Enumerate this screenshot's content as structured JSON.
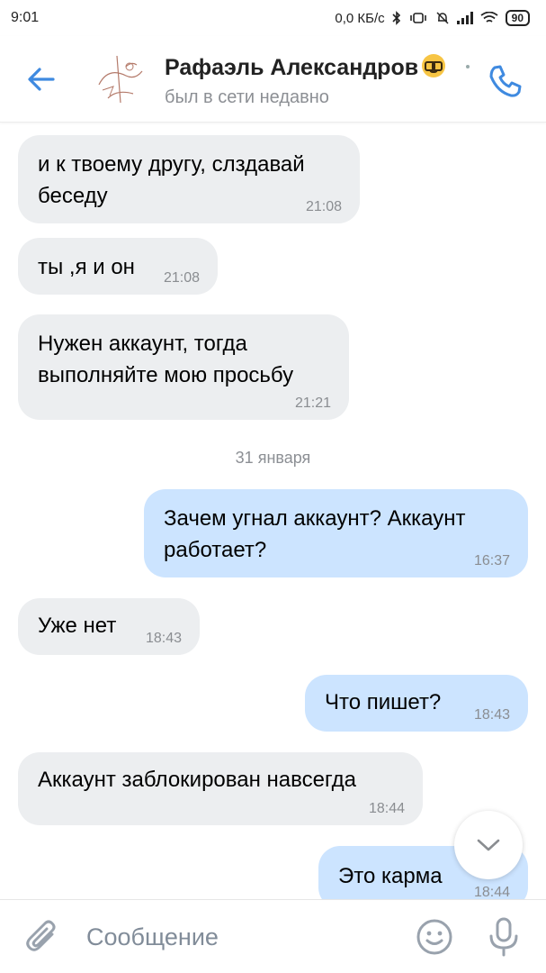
{
  "status_bar": {
    "time": "9:01",
    "net_speed": "0,0 КБ/с",
    "battery": "90"
  },
  "header": {
    "name": "Рафаэль Александров",
    "status": "был в сети недавно"
  },
  "messages": [
    {
      "dir": "in",
      "text": "и к твоему другу, слздавай\nбеседу",
      "time": "21:08"
    },
    {
      "dir": "in",
      "text": "ты ,я и он",
      "time": "21:08"
    },
    {
      "dir": "in",
      "text": "Нужен аккаунт, тогда\nвыполняйте мою просьбу",
      "time": "21:21"
    },
    {
      "dir": "out",
      "text": "Зачем угнал аккаунт? Аккаунт\nработает?",
      "time": "16:37"
    },
    {
      "dir": "in",
      "text": "Уже нет",
      "time": "18:43"
    },
    {
      "dir": "out",
      "text": "Что пишет?",
      "time": "18:43"
    },
    {
      "dir": "in",
      "text": "Аккаунт заблокирован навсегда",
      "time": "18:44"
    },
    {
      "dir": "out",
      "text": "Это карма",
      "time": "18:44"
    }
  ],
  "date_separator": "31 января",
  "composer": {
    "placeholder": "Сообщение"
  },
  "colors": {
    "accent": "#3f8ae0",
    "incoming_bubble": "#eceef0",
    "outgoing_bubble": "#cce4ff"
  },
  "icons": [
    "back-arrow-icon",
    "phone-icon",
    "attach-icon",
    "smile-icon",
    "mic-icon",
    "chevron-down-icon"
  ]
}
